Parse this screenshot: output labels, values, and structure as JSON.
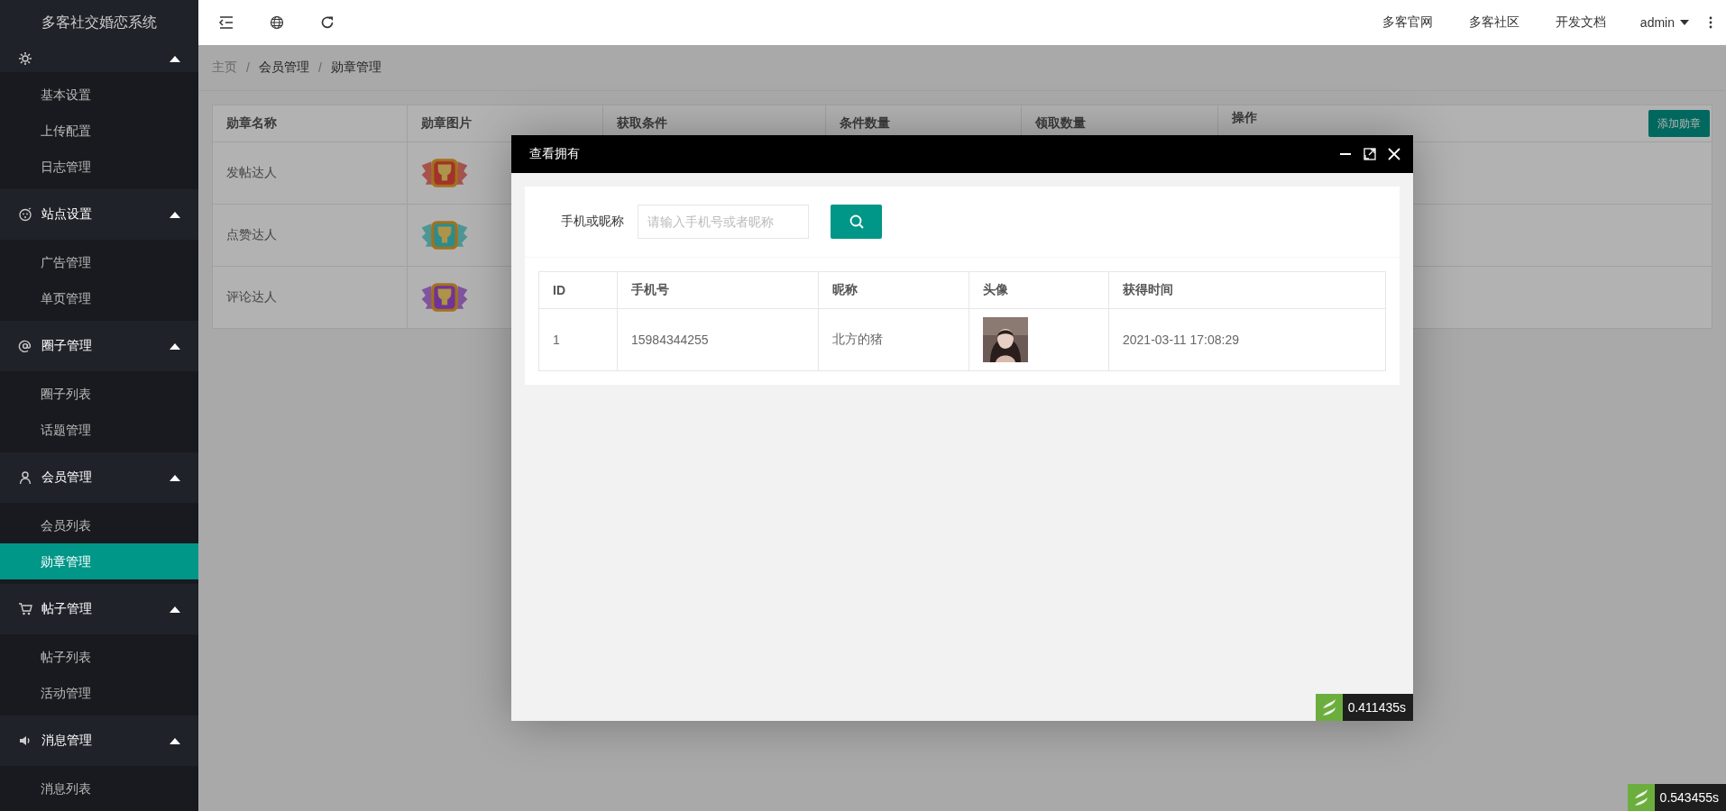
{
  "app": {
    "title": "多客社交婚恋系统"
  },
  "sidebar": {
    "groups": [
      {
        "expanded": true,
        "items": [
          {
            "label": "基本设置",
            "selected": false
          },
          {
            "label": "上传配置",
            "selected": false
          },
          {
            "label": "日志管理",
            "selected": false
          }
        ]
      },
      {
        "label": "站点设置",
        "expanded": true,
        "items": [
          {
            "label": "广告管理",
            "selected": false
          },
          {
            "label": "单页管理",
            "selected": false
          }
        ]
      },
      {
        "label": "圈子管理",
        "expanded": true,
        "items": [
          {
            "label": "圈子列表",
            "selected": false
          },
          {
            "label": "话题管理",
            "selected": false
          }
        ]
      },
      {
        "label": "会员管理",
        "expanded": true,
        "items": [
          {
            "label": "会员列表",
            "selected": false
          },
          {
            "label": "勋章管理",
            "selected": true
          }
        ]
      },
      {
        "label": "帖子管理",
        "expanded": true,
        "items": [
          {
            "label": "帖子列表",
            "selected": false
          },
          {
            "label": "活动管理",
            "selected": false
          }
        ]
      },
      {
        "label": "消息管理",
        "expanded": true,
        "items": [
          {
            "label": "消息列表",
            "selected": false
          }
        ]
      }
    ]
  },
  "topbar": {
    "links": [
      "多客官网",
      "多客社区",
      "开发文档"
    ],
    "user": "admin"
  },
  "breadcrumb": {
    "separator": "/",
    "items": [
      "主页",
      "会员管理",
      "勋章管理"
    ]
  },
  "table": {
    "columns": [
      "勋章名称",
      "勋章图片",
      "获取条件",
      "条件数量",
      "领取数量",
      "操作"
    ],
    "add_button": "添加勋章",
    "rows": [
      {
        "name": "发帖达人",
        "color": "#a2322b"
      },
      {
        "name": "点赞达人",
        "color": "#2c8c8c"
      },
      {
        "name": "评论达人",
        "color": "#703497"
      }
    ]
  },
  "modal": {
    "title": "查看拥有",
    "search": {
      "label": "手机或昵称",
      "placeholder": "请输入手机号或者昵称"
    },
    "table": {
      "columns": [
        "ID",
        "手机号",
        "昵称",
        "头像",
        "获得时间"
      ],
      "rows": [
        {
          "id": "1",
          "phone": "15984344255",
          "nickname": "北方的猪",
          "time": "2021-03-11 17:08:29"
        }
      ]
    },
    "timer": "0.411435s"
  },
  "page_timer": "0.543455s"
}
